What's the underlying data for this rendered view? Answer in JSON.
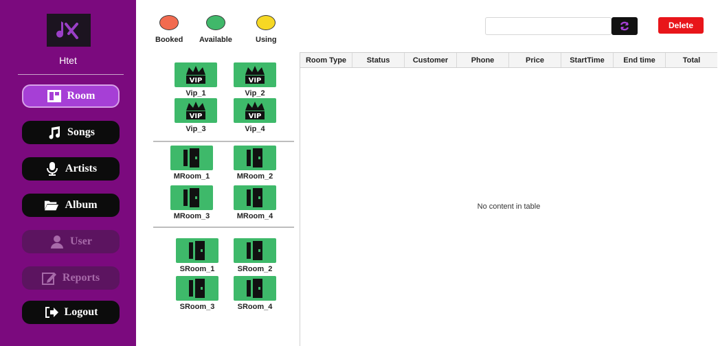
{
  "user": {
    "name": "Htet"
  },
  "sidebar": {
    "items": [
      {
        "label": "Room",
        "icon": "room-icon",
        "state": "active"
      },
      {
        "label": "Songs",
        "icon": "music-note-icon",
        "state": "normal"
      },
      {
        "label": "Artists",
        "icon": "microphone-icon",
        "state": "normal"
      },
      {
        "label": "Album",
        "icon": "folder-icon",
        "state": "normal"
      },
      {
        "label": "User",
        "icon": "user-icon",
        "state": "disabled"
      },
      {
        "label": "Reports",
        "icon": "edit-icon",
        "state": "disabled"
      },
      {
        "label": "Logout",
        "icon": "logout-icon",
        "state": "normal"
      }
    ]
  },
  "legend": {
    "booked": {
      "label": "Booked",
      "color": "#f26b50"
    },
    "available": {
      "label": "Available",
      "color": "#40b86a"
    },
    "using": {
      "label": "Using",
      "color": "#f6d824"
    }
  },
  "rooms": {
    "vip": [
      "Vip_1",
      "Vip_2",
      "Vip_3",
      "Vip_4"
    ],
    "vip_badge": "VIP",
    "medium": [
      "MRoom_1",
      "MRoom_2",
      "MRoom_3",
      "MRoom_4"
    ],
    "small": [
      "SRoom_1",
      "SRoom_2",
      "SRoom_3",
      "SRoom_4"
    ]
  },
  "toolbar": {
    "search_value": "",
    "delete_label": "Delete"
  },
  "table": {
    "columns": [
      "Room Type",
      "Status",
      "Customer",
      "Phone",
      "Price",
      "StartTime",
      "End time",
      "Total"
    ],
    "empty_message": "No content in table"
  },
  "colors": {
    "sidebar_bg": "#7b0a7e",
    "active_nav": "#a63fd6",
    "room_available": "#3eb96a",
    "delete": "#e8151a"
  }
}
